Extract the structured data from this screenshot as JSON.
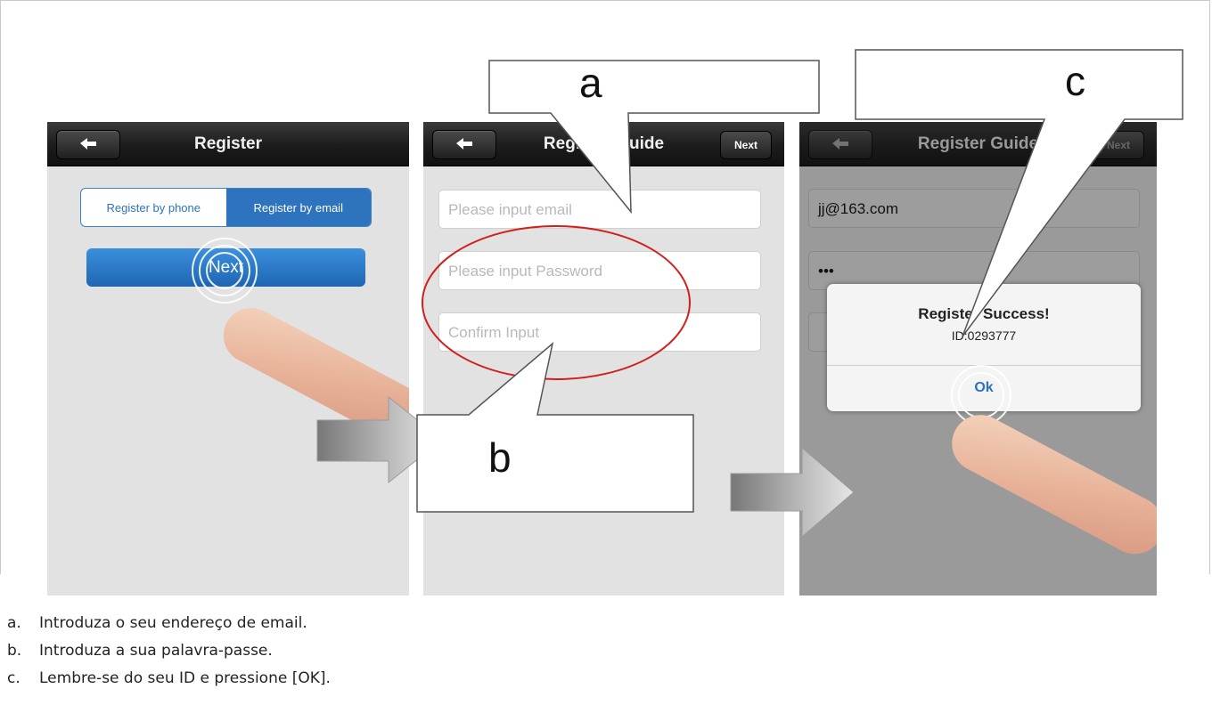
{
  "screen1": {
    "title": "Register",
    "tabs": [
      {
        "label": "Register by phone",
        "active": false
      },
      {
        "label": "Register by email",
        "active": true
      }
    ],
    "next_button": "Next"
  },
  "screen2": {
    "title": "Register Guide",
    "next_button": "Next",
    "fields": {
      "email_placeholder": "Please input email",
      "password_placeholder": "Please input Password",
      "confirm_placeholder": "Confirm Input"
    }
  },
  "screen3": {
    "title": "Register Guide",
    "next_button": "Next",
    "fields": {
      "email_value": "jj@163.com",
      "password_value": "•••"
    },
    "dialog": {
      "title": "Register Success!",
      "id_text": "ID:0293777",
      "ok_button": "Ok"
    }
  },
  "callouts": {
    "a": "a",
    "b": "b",
    "c": "c"
  },
  "captions": [
    {
      "marker": "a.",
      "text": "Introduza o seu endereço de email."
    },
    {
      "marker": "b.",
      "text": "Introduza a sua palavra-passe."
    },
    {
      "marker": "c.",
      "text": "Lembre-se do seu ID e pressione [OK]."
    }
  ],
  "colors": {
    "accent_blue": "#2d73bd",
    "highlight_red": "#d0201c",
    "arrow_gray": "#8a8a8a"
  }
}
